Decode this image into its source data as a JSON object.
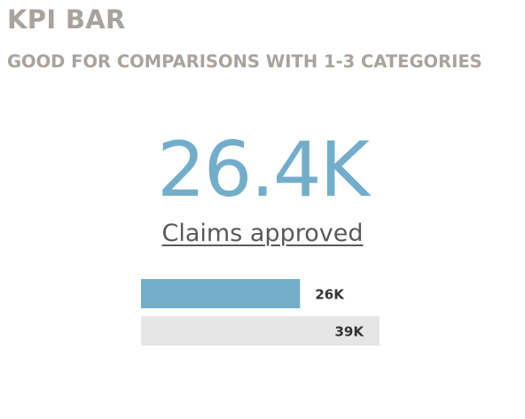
{
  "header": {
    "title": "KPI BAR",
    "subtitle": "GOOD FOR COMPARISONS WITH 1-3 CATEGORIES"
  },
  "kpi": {
    "value": "26.4K",
    "label": "Claims approved"
  },
  "colors": {
    "title": "#a8a39d",
    "kpi_value": "#72aecb",
    "actual_bar": "#72aecb",
    "target_bar": "#e6e6e6",
    "label_text": "#333333"
  },
  "chart_data": {
    "type": "bar",
    "orientation": "horizontal",
    "values": [
      26,
      39
    ],
    "value_labels": [
      "26K",
      "39K"
    ],
    "units": "K",
    "xlim": [
      0,
      39
    ],
    "grid": false,
    "legend": "none"
  }
}
